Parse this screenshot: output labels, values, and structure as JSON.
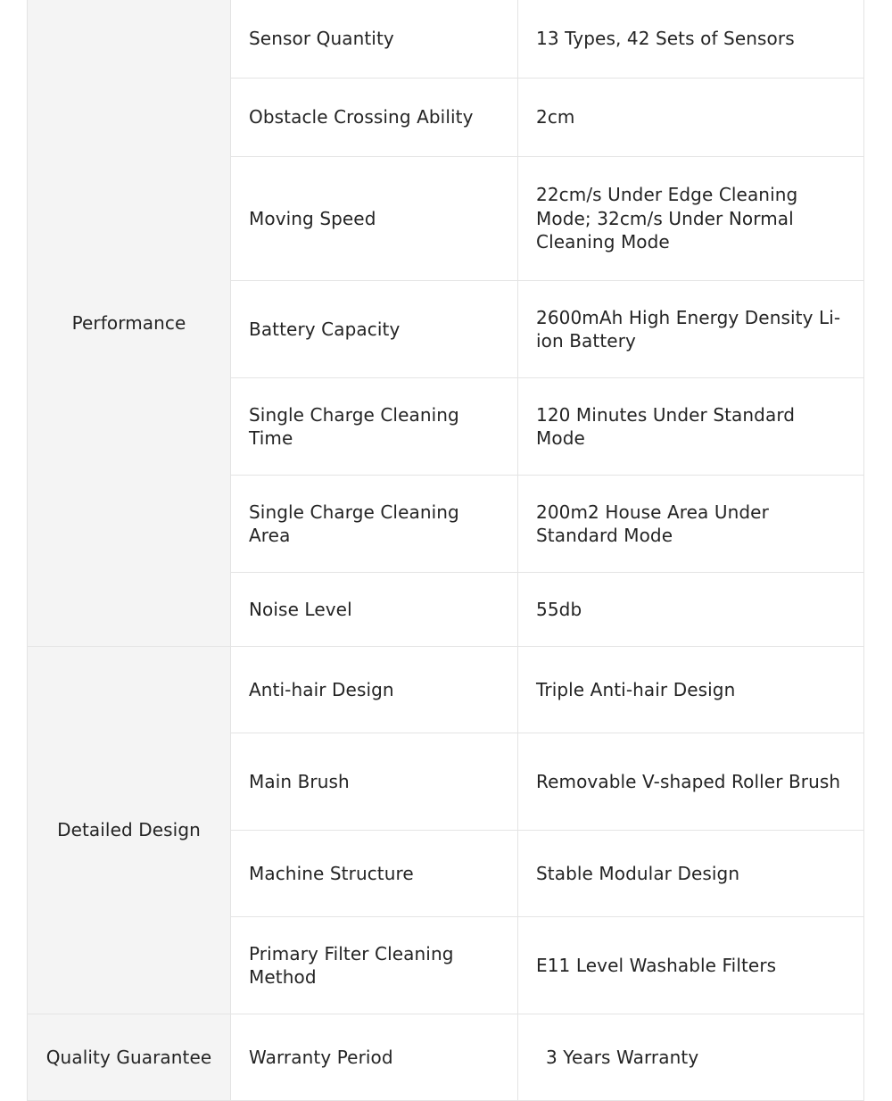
{
  "table": {
    "groups": [
      {
        "label": "Performance",
        "rows": [
          {
            "param": "Sensor Quantity",
            "value": "13 Types, 42 Sets of Sensors"
          },
          {
            "param": "Obstacle Crossing Ability",
            "value": "2cm"
          },
          {
            "param": "Moving Speed",
            "value": "22cm/s Under Edge Cleaning Mode; 32cm/s Under Normal Cleaning Mode"
          },
          {
            "param": "Battery Capacity",
            "value": "2600mAh High Energy Density Li-ion Battery"
          },
          {
            "param": "Single Charge Cleaning Time",
            "value": "120 Minutes Under Standard Mode"
          },
          {
            "param": "Single Charge Cleaning Area",
            "value": "200m2 House Area Under Standard Mode"
          },
          {
            "param": "Noise Level",
            "value": "55db"
          }
        ]
      },
      {
        "label": "Detailed Design",
        "rows": [
          {
            "param": "Anti-hair Design",
            "value": "Triple Anti-hair Design"
          },
          {
            "param": "Main Brush",
            "value": "Removable V-shaped Roller Brush"
          },
          {
            "param": "Machine Structure",
            "value": "Stable Modular Design"
          },
          {
            "param": "Primary Filter Cleaning Method",
            "value": "E11 Level Washable Filters"
          }
        ]
      },
      {
        "label": "Quality Guarantee",
        "rows": [
          {
            "param": "Warranty Period",
            "value": "3 Years Warranty"
          }
        ]
      }
    ]
  },
  "colors": {
    "group_background": "#f4f4f4",
    "cell_background": "#ffffff",
    "border": "#e4e4e4",
    "text": "#242424"
  }
}
